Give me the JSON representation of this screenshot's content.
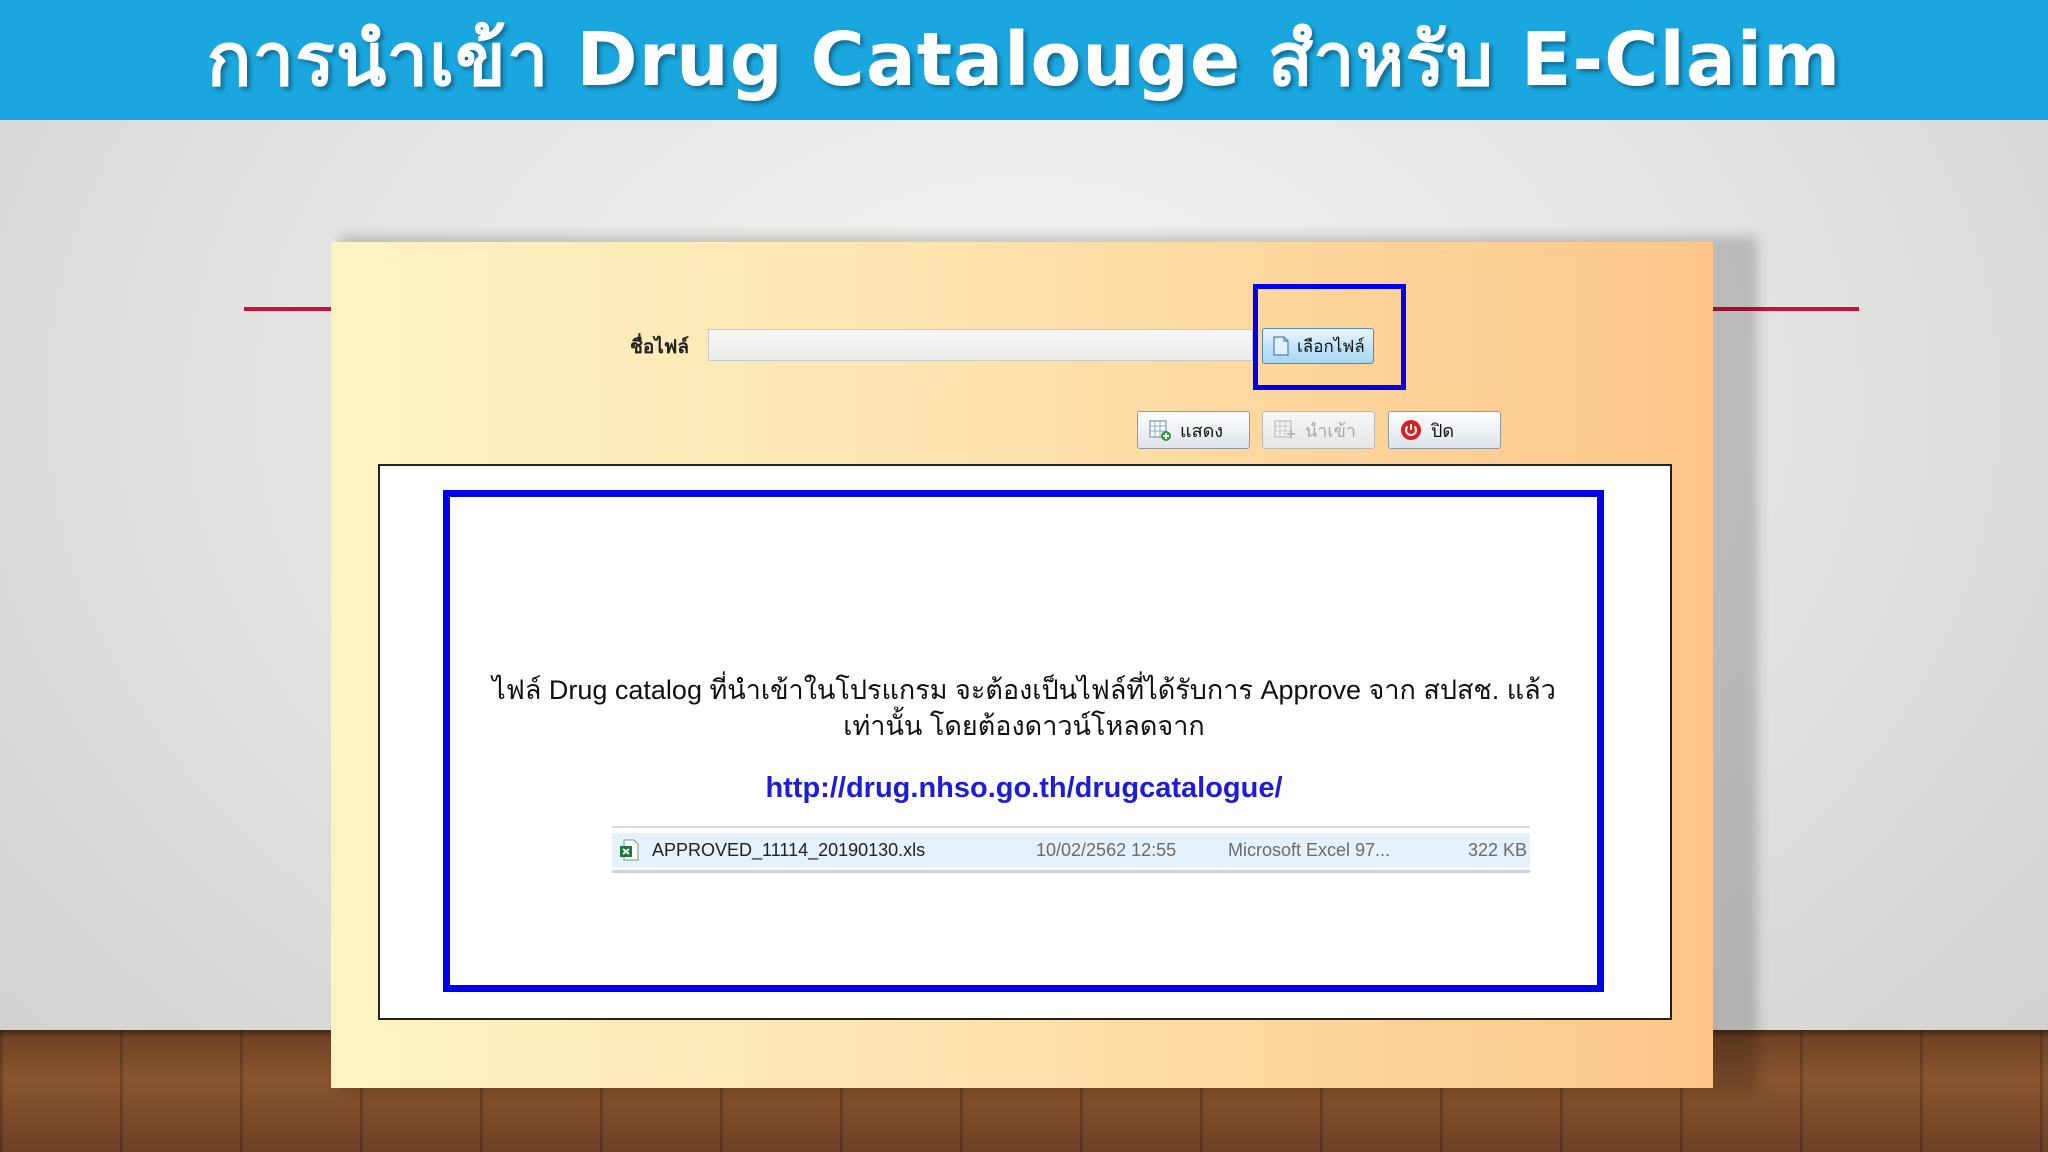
{
  "title": "การนำเข้า Drug Catalouge สำหรับ E-Claim",
  "form": {
    "file_label": "ชื่อไฟล์",
    "file_input_value": "",
    "choose_file_label": "เลือกไฟล์",
    "buttons": {
      "show_label": "แสดง",
      "import_label": "นำเข้า",
      "close_label": "ปิด"
    }
  },
  "info": {
    "message": "ไฟล์ Drug catalog ที่นำเข้าในโปรแกรม จะต้องเป็นไฟล์ที่ได้รับการ Approve จาก สปสช. แล้วเท่านั้น โดยต้องดาวน์โหลดจาก",
    "url": "http://drug.nhso.go.th/drugcatalogue/"
  },
  "file_row": {
    "name": "APPROVED_11114_20190130.xls",
    "date": "10/02/2562 12:55",
    "type": "Microsoft Excel 97...",
    "size": "322 KB"
  },
  "colors": {
    "title_bar": "#1aa7e0",
    "highlight": "#0000ee",
    "link": "#1d1dd6",
    "accent_line": "#c0143c"
  },
  "icons": {
    "choose_file": "document-icon",
    "show": "grid-add-icon",
    "import": "grid-import-icon",
    "close": "power-icon",
    "excel": "excel-file-icon"
  }
}
